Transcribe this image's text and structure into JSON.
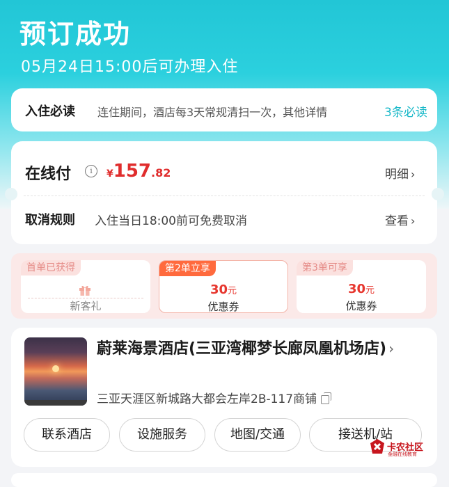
{
  "header": {
    "title": "预订成功",
    "subtitle": "05月24日15:00后可办理入住"
  },
  "notice": {
    "label": "入住必读",
    "text": "连住期间，酒店每3天常规清扫一次，其他详情",
    "more": "3条必读"
  },
  "payment": {
    "label": "在线付",
    "currency": "¥",
    "price_int": "157",
    "price_dec": ".82",
    "detail_label": "明细",
    "cancel_label": "取消规则",
    "cancel_text": "入住当日18:00前可免费取消",
    "view_label": "查看"
  },
  "coupons": [
    {
      "tag": "首单已获得",
      "amount": "",
      "unit": "",
      "name": "新客礼",
      "active": false
    },
    {
      "tag": "第2单立享",
      "amount": "30",
      "unit": "元",
      "name": "优惠券",
      "active": true
    },
    {
      "tag": "第3单可享",
      "amount": "30",
      "unit": "元",
      "name": "优惠券",
      "active": false
    }
  ],
  "hotel": {
    "name": "蔚莱海景酒店(三亚湾椰梦长廊凤凰机场店)",
    "address": "三亚天涯区新城路大都会左岸2B-117商铺",
    "buttons": [
      "联系酒店",
      "设施服务",
      "地图/交通",
      "接送机/站"
    ]
  },
  "watermark": {
    "brand": "卡农社区",
    "tagline": "金融在线教育"
  },
  "colors": {
    "accent": "#1fc3d3",
    "price": "#e02d2d",
    "coupon_tag": "#ff6a3d"
  }
}
